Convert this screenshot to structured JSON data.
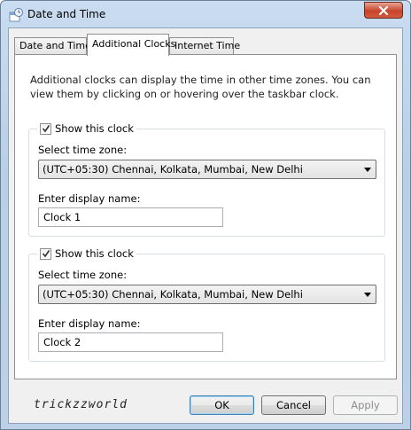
{
  "window": {
    "title": "Date and Time"
  },
  "tabs": [
    {
      "label": "Date and Time"
    },
    {
      "label": "Additional Clocks"
    },
    {
      "label": "Internet Time"
    }
  ],
  "intro_text": "Additional clocks can display the time in other time zones. You can view them by clicking on or hovering over the taskbar clock.",
  "clocks": [
    {
      "show_label": "Show this clock",
      "show_checked": true,
      "timezone_label": "Select time zone:",
      "timezone_value": "(UTC+05:30) Chennai, Kolkata, Mumbai, New Delhi",
      "name_label": "Enter display name:",
      "name_value": "Clock 1"
    },
    {
      "show_label": "Show this clock",
      "show_checked": true,
      "timezone_label": "Select time zone:",
      "timezone_value": "(UTC+05:30) Chennai, Kolkata, Mumbai, New Delhi",
      "name_label": "Enter display name:",
      "name_value": "Clock 2"
    }
  ],
  "watermark": "trickzzworld",
  "buttons": {
    "ok": "OK",
    "cancel": "Cancel",
    "apply": "Apply"
  }
}
